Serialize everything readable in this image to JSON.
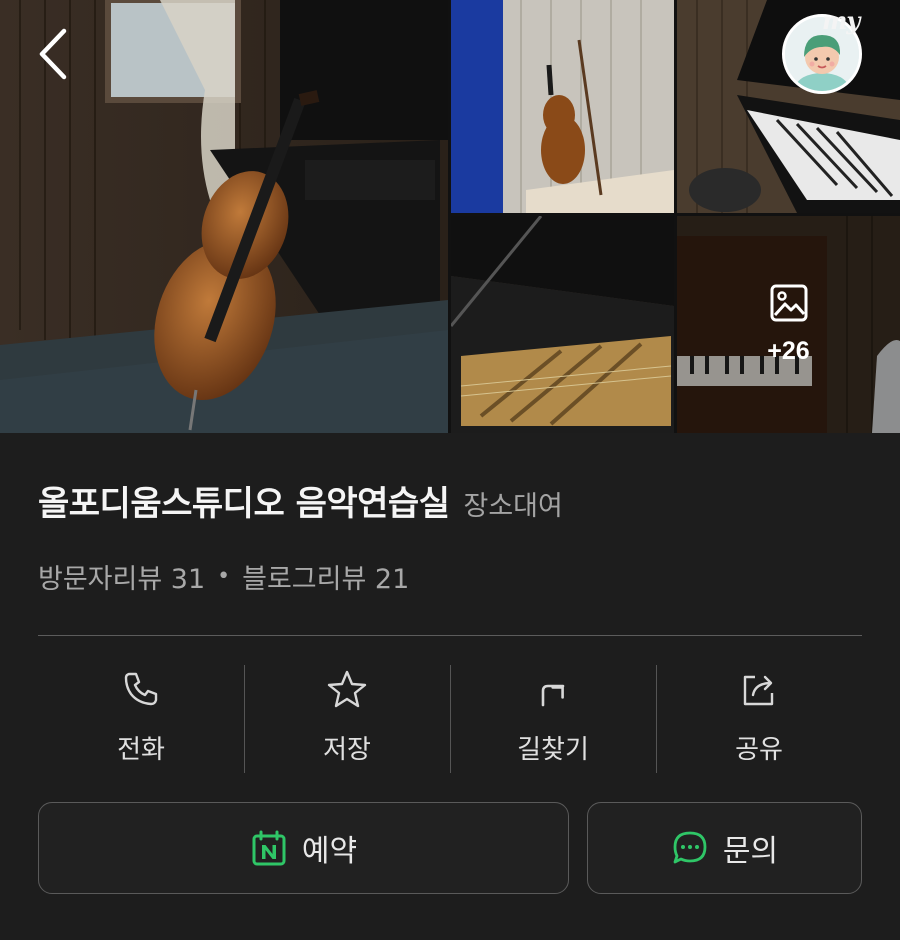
{
  "gallery": {
    "more_count": "+26",
    "avatar_tag": "my"
  },
  "place": {
    "name": "올포디움스튜디오 음악연습실",
    "category": "장소대여",
    "visitor_reviews": "방문자리뷰 31",
    "separator": "•",
    "blog_reviews": "블로그리뷰 21"
  },
  "actions": [
    {
      "label": "전화",
      "icon": "phone-icon"
    },
    {
      "label": "저장",
      "icon": "star-icon"
    },
    {
      "label": "길찾기",
      "icon": "directions-icon"
    },
    {
      "label": "공유",
      "icon": "share-icon"
    }
  ],
  "buttons": {
    "reserve_label": "예약",
    "reserve_icon": "naver-calendar-icon",
    "inquiry_label": "문의",
    "inquiry_icon": "chat-bubble-icon"
  },
  "colors": {
    "background": "#1d1d1d",
    "accent_green": "#2fc667",
    "divider": "#5c5c5c"
  }
}
